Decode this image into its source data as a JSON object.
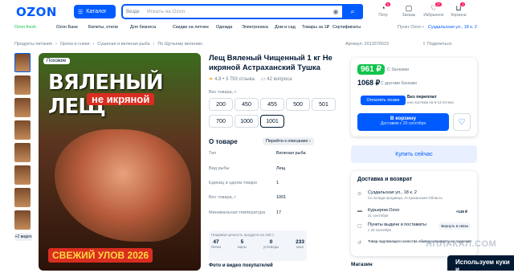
{
  "header": {
    "logo": "OZON",
    "catalog": "Каталог",
    "search_scope": "Везде",
    "search_placeholder": "Искать на Ozon",
    "user": [
      {
        "label": "Петр",
        "badge": "5"
      },
      {
        "label": "Заказы",
        "badge": ""
      },
      {
        "label": "Избранное",
        "badge": "27"
      },
      {
        "label": "Корзина",
        "badge": "4"
      }
    ]
  },
  "nav": [
    "Ozon fresh",
    "Ozon Банк",
    "Билеты, отели",
    "Для бизнеса",
    "Скидки на летнее",
    "Одежда",
    "Электроника",
    "Дом и сад",
    "Товары за 1₽",
    "Сертификаты",
    "Пункт Ozon •",
    "Суздальская ул., 18 к. 2"
  ],
  "breadcrumbs": [
    "Продукты питания",
    "Орехи и снеки",
    "Сушеная и вяленая рыба",
    "По Щучьему велению"
  ],
  "actions": {
    "article": "Артикул: 2013376515",
    "share": "Поделиться"
  },
  "thumbs_more": "+2 видео",
  "image": {
    "pill": "Похожие",
    "line1": "ВЯЛЕНЫЙ ЛЕЩ",
    "line2": "не икряной",
    "line3": "СВЕЖИЙ УЛОВ 2026"
  },
  "product": {
    "title": "Лещ Вяленый Чищенный 1 кг Не икряной Астраханский Тушка",
    "rating": "4.8 • 3 793 отзыва",
    "questions": "42 вопроса",
    "weight_label": "Вес товара, г:",
    "weights": [
      "200",
      "450",
      "455",
      "500",
      "501",
      "700",
      "1000",
      "1001"
    ],
    "about": "О товаре",
    "to_desc": "Перейти к описанию",
    "specs": [
      {
        "k": "Тип",
        "v": "Вяленая рыба"
      },
      {
        "k": "Вид рыбы",
        "v": "Лещ"
      },
      {
        "k": "Единиц в одном товаре",
        "v": "1"
      },
      {
        "k": "Вес товара, г",
        "v": "1001"
      },
      {
        "k": "Минимальная температура",
        "v": "17"
      }
    ],
    "nutri_head": "Пищевая ценность продукта на 100 г:",
    "nutri": [
      {
        "v": "47",
        "u": "белки"
      },
      {
        "v": "5",
        "u": "жиры"
      },
      {
        "v": "0",
        "u": "углеводы"
      },
      {
        "v": "233",
        "u": "ккал"
      }
    ],
    "photos": "Фото и видео покупателей"
  },
  "buy": {
    "card_price": "961 ₽",
    "with_bank": "С банками",
    "price": "1068 ₽",
    "other": "С другими банками",
    "installment_btn": "Оплатить позже",
    "installment_title": "Без переплат",
    "installment_sub": "или частями на 6-12-24 мес",
    "cart": "В корзину",
    "cart_sub": "Доставим с 20 сентября",
    "buy_now": "Купить сейчас"
  },
  "delivery": {
    "title": "Доставка и возврат",
    "rows": [
      {
        "a": "Суздальская ул., 18 к. 2",
        "b": "Со склада продавца, Астраханская Область",
        "r": "",
        "btn": ""
      },
      {
        "a": "Курьером Ozon",
        "b": "21 сентября",
        "r": "+149 ₽",
        "btn": ""
      },
      {
        "a": "Пункты выдачи и постаматы",
        "b": "с 20 сентября",
        "r": "",
        "btn": "Вернуть в связи"
      },
      {
        "a": "Товар надлежащего качества обмену и возврату не подлежит",
        "b": "",
        "r": "",
        "btn": ""
      }
    ]
  },
  "shop": "Магазин",
  "cookie": "Используем куки и",
  "watermark": "ЯПЛАКАЛ.COM"
}
